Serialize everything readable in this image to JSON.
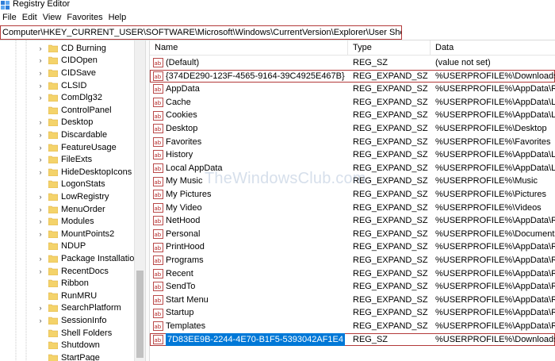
{
  "window": {
    "title": "Registry Editor"
  },
  "menu": [
    "File",
    "Edit",
    "View",
    "Favorites",
    "Help"
  ],
  "address": "Computer\\HKEY_CURRENT_USER\\SOFTWARE\\Microsoft\\Windows\\CurrentVersion\\Explorer\\User Shell Folders",
  "tree": [
    {
      "label": "CD Burning",
      "expander": "›"
    },
    {
      "label": "CIDOpen",
      "expander": "›"
    },
    {
      "label": "CIDSave",
      "expander": "›"
    },
    {
      "label": "CLSID",
      "expander": "›"
    },
    {
      "label": "ComDlg32",
      "expander": "›"
    },
    {
      "label": "ControlPanel",
      "expander": ""
    },
    {
      "label": "Desktop",
      "expander": "›"
    },
    {
      "label": "Discardable",
      "expander": "›"
    },
    {
      "label": "FeatureUsage",
      "expander": "›"
    },
    {
      "label": "FileExts",
      "expander": "›"
    },
    {
      "label": "HideDesktopIcons",
      "expander": "›"
    },
    {
      "label": "LogonStats",
      "expander": ""
    },
    {
      "label": "LowRegistry",
      "expander": "›"
    },
    {
      "label": "MenuOrder",
      "expander": "›"
    },
    {
      "label": "Modules",
      "expander": "›"
    },
    {
      "label": "MountPoints2",
      "expander": "›"
    },
    {
      "label": "NDUP",
      "expander": ""
    },
    {
      "label": "Package Installation",
      "expander": "›"
    },
    {
      "label": "RecentDocs",
      "expander": "›"
    },
    {
      "label": "Ribbon",
      "expander": ""
    },
    {
      "label": "RunMRU",
      "expander": ""
    },
    {
      "label": "SearchPlatform",
      "expander": "›"
    },
    {
      "label": "SessionInfo",
      "expander": "›"
    },
    {
      "label": "Shell Folders",
      "expander": ""
    },
    {
      "label": "Shutdown",
      "expander": ""
    },
    {
      "label": "StartPage",
      "expander": ""
    }
  ],
  "columns": {
    "name": "Name",
    "type": "Type",
    "data": "Data"
  },
  "rows": [
    {
      "name": "(Default)",
      "type": "REG_SZ",
      "data": "(value not set)"
    },
    {
      "name": "{374DE290-123F-4565-9164-39C4925E467B}",
      "type": "REG_EXPAND_SZ",
      "data": "%USERPROFILE%\\Downloads",
      "boxed": true
    },
    {
      "name": "AppData",
      "type": "REG_EXPAND_SZ",
      "data": "%USERPROFILE%\\AppData\\Roaming"
    },
    {
      "name": "Cache",
      "type": "REG_EXPAND_SZ",
      "data": "%USERPROFILE%\\AppData\\Local\\Microsoft"
    },
    {
      "name": "Cookies",
      "type": "REG_EXPAND_SZ",
      "data": "%USERPROFILE%\\AppData\\Local\\Microsoft"
    },
    {
      "name": "Desktop",
      "type": "REG_EXPAND_SZ",
      "data": "%USERPROFILE%\\Desktop"
    },
    {
      "name": "Favorites",
      "type": "REG_EXPAND_SZ",
      "data": "%USERPROFILE%\\Favorites"
    },
    {
      "name": "History",
      "type": "REG_EXPAND_SZ",
      "data": "%USERPROFILE%\\AppData\\Local\\Microsoft"
    },
    {
      "name": "Local AppData",
      "type": "REG_EXPAND_SZ",
      "data": "%USERPROFILE%\\AppData\\Local"
    },
    {
      "name": "My Music",
      "type": "REG_EXPAND_SZ",
      "data": "%USERPROFILE%\\Music"
    },
    {
      "name": "My Pictures",
      "type": "REG_EXPAND_SZ",
      "data": "%USERPROFILE%\\Pictures"
    },
    {
      "name": "My Video",
      "type": "REG_EXPAND_SZ",
      "data": "%USERPROFILE%\\Videos"
    },
    {
      "name": "NetHood",
      "type": "REG_EXPAND_SZ",
      "data": "%USERPROFILE%\\AppData\\Roaming\\Microsoft"
    },
    {
      "name": "Personal",
      "type": "REG_EXPAND_SZ",
      "data": "%USERPROFILE%\\Documents"
    },
    {
      "name": "PrintHood",
      "type": "REG_EXPAND_SZ",
      "data": "%USERPROFILE%\\AppData\\Roaming\\Microsoft"
    },
    {
      "name": "Programs",
      "type": "REG_EXPAND_SZ",
      "data": "%USERPROFILE%\\AppData\\Roaming\\Microsoft"
    },
    {
      "name": "Recent",
      "type": "REG_EXPAND_SZ",
      "data": "%USERPROFILE%\\AppData\\Roaming\\Microsoft"
    },
    {
      "name": "SendTo",
      "type": "REG_EXPAND_SZ",
      "data": "%USERPROFILE%\\AppData\\Roaming\\Microsoft"
    },
    {
      "name": "Start Menu",
      "type": "REG_EXPAND_SZ",
      "data": "%USERPROFILE%\\AppData\\Roaming\\Microsoft"
    },
    {
      "name": "Startup",
      "type": "REG_EXPAND_SZ",
      "data": "%USERPROFILE%\\AppData\\Roaming\\Microsoft"
    },
    {
      "name": "Templates",
      "type": "REG_EXPAND_SZ",
      "data": "%USERPROFILE%\\AppData\\Roaming\\Microsoft"
    },
    {
      "name": "7D83EE9B-2244-4E70-B1F5-5393042AF1E4",
      "type": "REG_SZ",
      "data": "%USERPROFILE%\\Downloads",
      "boxed": true,
      "selected": true
    }
  ],
  "watermark": "TheWindowsClub.com",
  "colors": {
    "accent_box": "#b33a3a",
    "selection": "#0078d7",
    "folder": "#f4d36b"
  }
}
